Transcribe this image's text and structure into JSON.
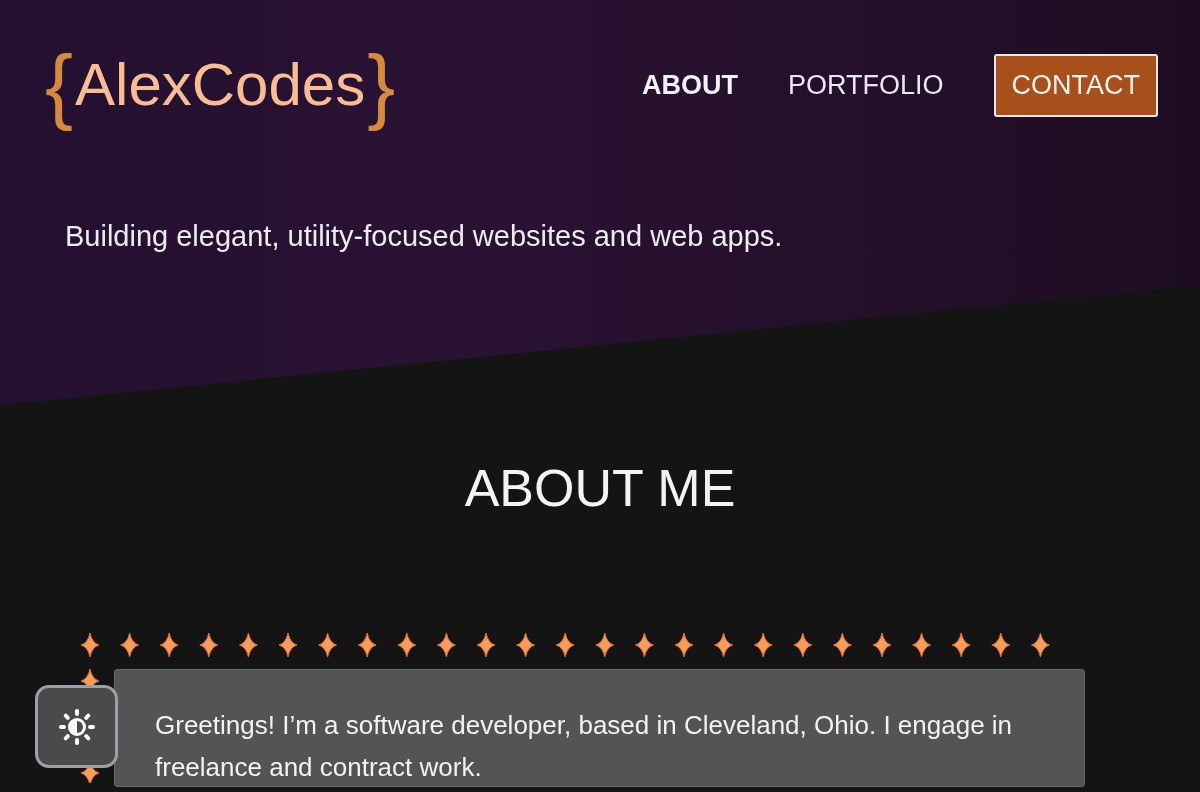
{
  "header": {
    "logo": {
      "open_brace": "{",
      "name": "AlexCodes",
      "close_brace": "}"
    },
    "nav": [
      {
        "label": "ABOUT",
        "kind": "link",
        "selected": true
      },
      {
        "label": "PORTFOLIO",
        "kind": "link",
        "selected": false
      },
      {
        "label": "CONTACT",
        "kind": "button",
        "selected": false
      }
    ],
    "tagline": "Building elegant, utility-focused websites and web apps."
  },
  "about": {
    "heading": "ABOUT ME",
    "text": "Greetings! I’m a software developer, based in Cleveland, Ohio. I engage in freelance and contract work."
  }
}
